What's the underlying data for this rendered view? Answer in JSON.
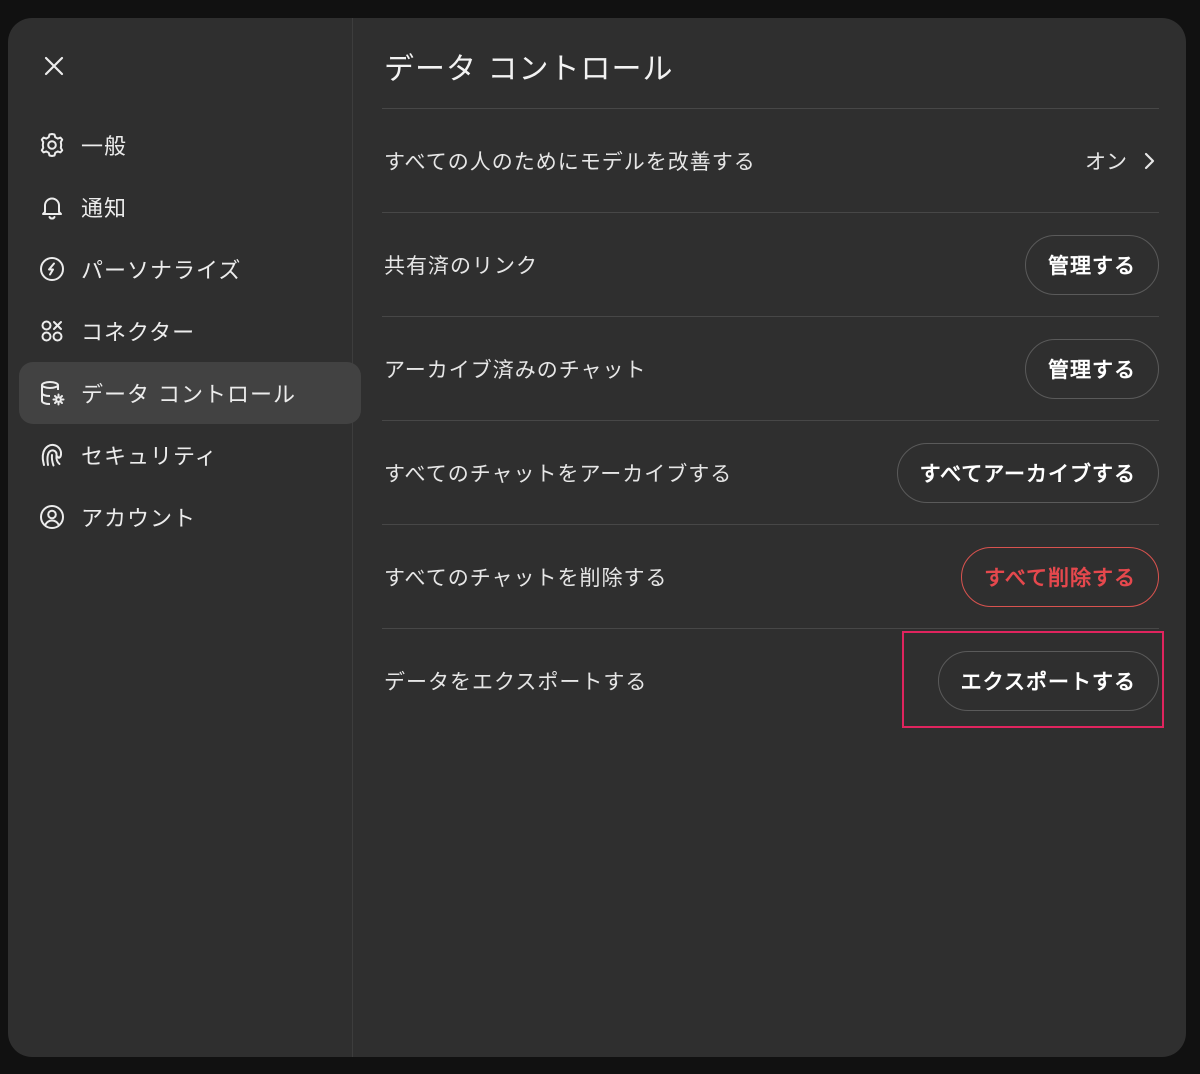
{
  "sidebar": {
    "items": [
      {
        "label": "一般",
        "icon": "gear-icon",
        "active": false
      },
      {
        "label": "通知",
        "icon": "bell-icon",
        "active": false
      },
      {
        "label": "パーソナライズ",
        "icon": "personalize-icon",
        "active": false
      },
      {
        "label": "コネクター",
        "icon": "connector-icon",
        "active": false
      },
      {
        "label": "データ コントロール",
        "icon": "database-gear-icon",
        "active": true
      },
      {
        "label": "セキュリティ",
        "icon": "fingerprint-icon",
        "active": false
      },
      {
        "label": "アカウント",
        "icon": "user-circle-icon",
        "active": false
      }
    ]
  },
  "main": {
    "title": "データ コントロール",
    "rows": [
      {
        "label": "すべての人のためにモデルを改善する",
        "value": "オン"
      },
      {
        "label": "共有済のリンク",
        "button": "管理する"
      },
      {
        "label": "アーカイブ済みのチャット",
        "button": "管理する"
      },
      {
        "label": "すべてのチャットをアーカイブする",
        "button": "すべてアーカイブする"
      },
      {
        "label": "すべてのチャットを削除する",
        "button": "すべて削除する"
      },
      {
        "label": "データをエクスポートする",
        "button": "エクスポートする"
      }
    ]
  },
  "colors": {
    "modal_bg": "#2f2f2f",
    "active_bg": "#424242",
    "danger": "#e5484d",
    "highlight": "#e0245e"
  }
}
